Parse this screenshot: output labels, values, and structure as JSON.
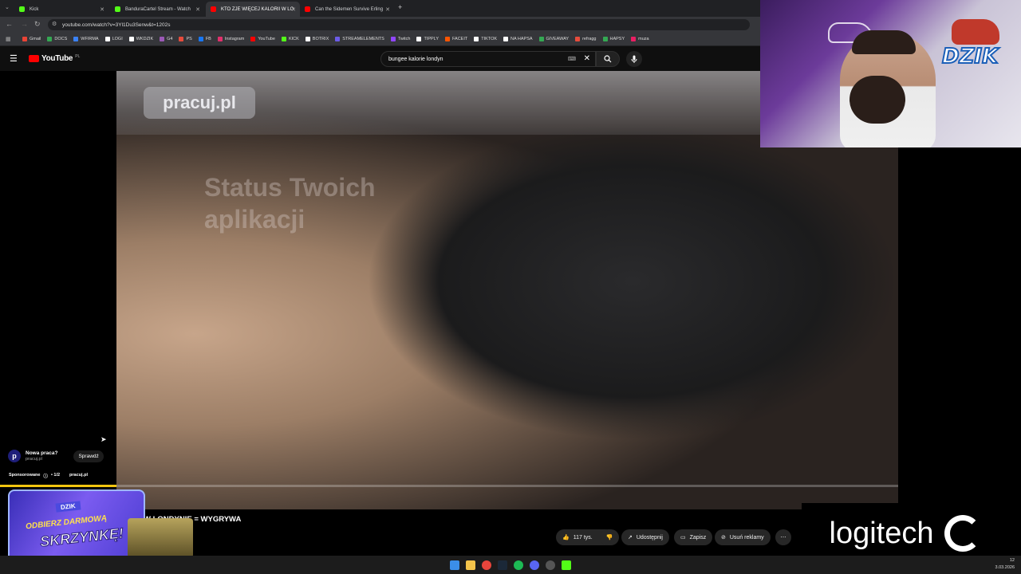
{
  "tabs": [
    {
      "label": "Kick",
      "color": "#53fc18"
    },
    {
      "label": "BanduraCartel Stream - Watch",
      "color": "#53fc18"
    },
    {
      "label": "KTO ZJE WIĘCEJ KALORII W LO",
      "color": "#ff0000"
    },
    {
      "label": "Can the Sidemen Survive Erling",
      "color": "#ff0000"
    }
  ],
  "new_tab": "+",
  "url": "youtube.com/watch?v=3Yl1Du3Senw&t=1202s",
  "bookmarks": [
    {
      "label": "Gmail",
      "color": "#ea4335"
    },
    {
      "label": "DOCS",
      "color": "#34a853"
    },
    {
      "label": "WFIRMA",
      "color": "#3b82f6"
    },
    {
      "label": "LOGI",
      "color": "#ffffff"
    },
    {
      "label": "WKDZIK",
      "color": "#ffffff"
    },
    {
      "label": "G4",
      "color": "#9b59b6"
    },
    {
      "label": "PS",
      "color": "#e74c3c"
    },
    {
      "label": "FB",
      "color": "#1877f2"
    },
    {
      "label": "Instagram",
      "color": "#e1306c"
    },
    {
      "label": "YouTube",
      "color": "#ff0000"
    },
    {
      "label": "KICK",
      "color": "#53fc18"
    },
    {
      "label": "BOTRIX",
      "color": "#ffffff"
    },
    {
      "label": "STREAMELEMENTS",
      "color": "#6c5ce7"
    },
    {
      "label": "Twitch",
      "color": "#9146ff"
    },
    {
      "label": "TIPPLY",
      "color": "#ffffff"
    },
    {
      "label": "FACEIT",
      "color": "#ff5500"
    },
    {
      "label": "TIKTOK",
      "color": "#ffffff"
    },
    {
      "label": "NA HAPSA",
      "color": "#ffffff"
    },
    {
      "label": "GIVEAWAY",
      "color": "#34a853"
    },
    {
      "label": "refragg",
      "color": "#e74c3c"
    },
    {
      "label": "HAPSY",
      "color": "#34a853"
    },
    {
      "label": "muza",
      "color": "#e91e63"
    }
  ],
  "youtube": {
    "logo": "YouTube",
    "region": "PL",
    "search_query": "bungee kalorie londyn",
    "video_title": "W LONDYNIE = WYGRYWA",
    "likes": "117 tys.",
    "share": "Udostępnij",
    "save": "Zapisz",
    "remove_ads": "Usuń reklamy"
  },
  "ad": {
    "logo_letter": "p",
    "headline": "Nowa praca?",
    "domain": "pracuj.pl",
    "cta": "Sprawdź",
    "sponsored": "Sponsorowane",
    "counter": "• 1/2",
    "advertiser": "pracuj.pl"
  },
  "video": {
    "watermark": "pracuj.pl",
    "blurred_text_1": "Status Twoich",
    "blurred_text_2": "aplikacji",
    "progress": 0.0
  },
  "overlay": {
    "brand": "DZIK",
    "logitech": "logitech",
    "promo_top": "DZIK",
    "promo_line1": "ODBIERZ DARMOWĄ",
    "promo_line2": "SKRZYNKĘ!"
  },
  "clock": {
    "time": "12",
    "date": "3.03.2026"
  }
}
